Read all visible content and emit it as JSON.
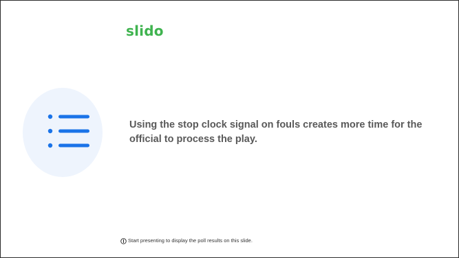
{
  "slide": {
    "logo_text": "slido",
    "question_text": "Using the stop clock signal on fouls  creates more time for the official to process the play.",
    "footer_text": "Start presenting to display the poll results on this slide."
  },
  "icons": {
    "poll_type": "list-icon",
    "footer": "info-icon"
  },
  "colors": {
    "brand_green": "#3fb34f",
    "icon_blue": "#1a73e8",
    "icon_bg": "#eef4fd",
    "question_text": "#595959"
  }
}
